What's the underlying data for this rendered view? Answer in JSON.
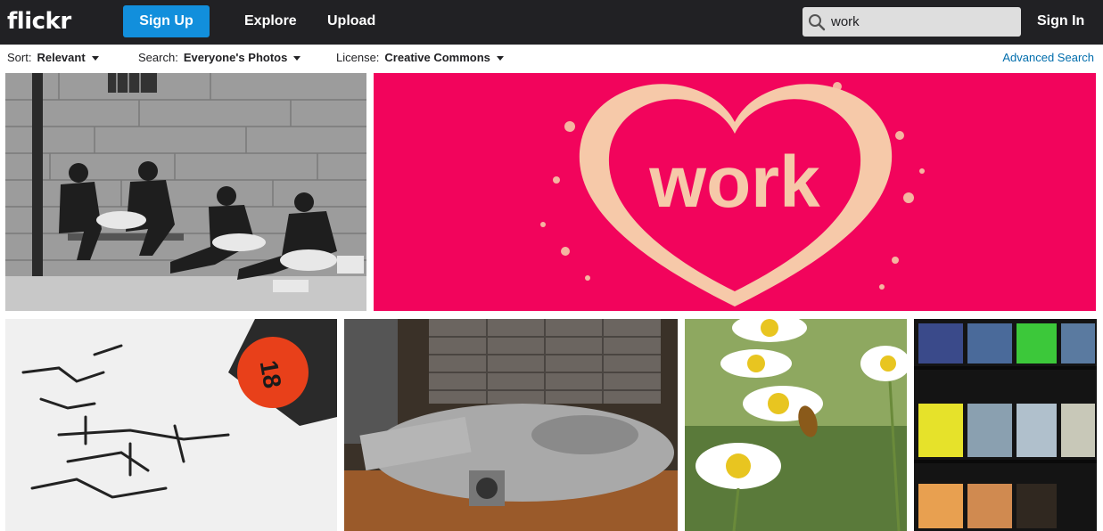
{
  "header": {
    "logo": "flickr",
    "signup_label": "Sign Up",
    "nav": {
      "explore": "Explore",
      "upload": "Upload"
    },
    "search": {
      "value": "work",
      "icon": "search-icon"
    },
    "signin_label": "Sign In"
  },
  "filters": {
    "sort": {
      "label": "Sort:",
      "value": "Relevant"
    },
    "search": {
      "label": "Search:",
      "value": "Everyone's Photos"
    },
    "license": {
      "label": "License:",
      "value": "Creative Commons"
    },
    "advanced_link": "Advanced Search"
  },
  "photos": [
    {
      "name": "workers-bw-photo"
    },
    {
      "name": "heart-work-photo",
      "caption": "work"
    },
    {
      "name": "marker-ink-photo",
      "marker_number": "18"
    },
    {
      "name": "lego-ship-photo"
    },
    {
      "name": "daisy-bee-photo"
    },
    {
      "name": "office-windows-photo"
    }
  ],
  "colors": {
    "topbar": "#212124",
    "accent": "#128fdc",
    "link": "#006dac",
    "heart_bg": "#f2045c"
  }
}
